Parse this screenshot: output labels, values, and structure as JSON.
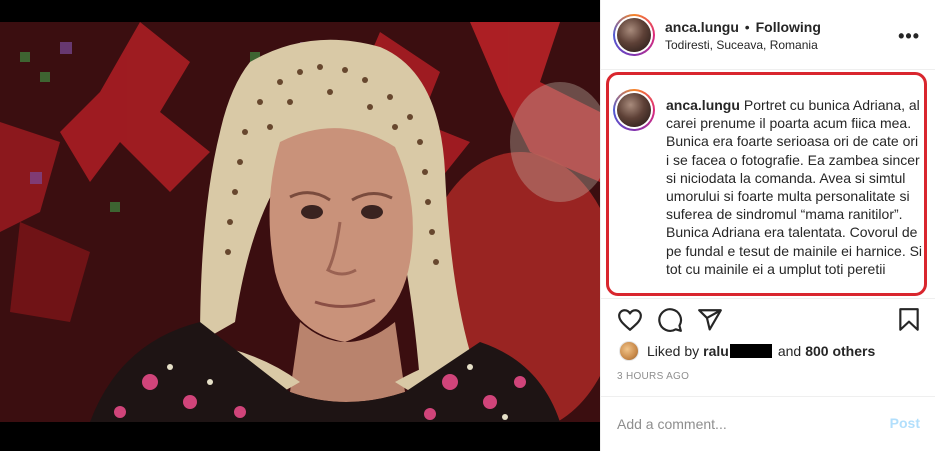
{
  "post": {
    "username": "anca.lungu",
    "separator": "•",
    "follow_status": "Following",
    "location": "Todiresti, Suceava, Romania",
    "more_label": "•••"
  },
  "caption": {
    "username": "anca.lungu",
    "text": "Portret cu bunica Adriana, al carei prenume il poarta acum fiica mea. Bunica era foarte serioasa ori de cate ori i se facea o fotografie. Ea zambea sincer si niciodata la comanda. Avea si simtul umorului si foarte multa personalitate si suferea de sindromul “mama ranitilor”. Bunica Adriana era talentata. Covorul de pe fundal e tesut de mainile ei harnice. Si tot cu mainile ei a umplut toti peretii"
  },
  "likes": {
    "prefix": "Liked by",
    "liker": "ralu",
    "and": "and",
    "others": "800 others"
  },
  "timestamp": "3 HOURS AGO",
  "comment": {
    "placeholder": "Add a comment...",
    "post_label": "Post"
  },
  "icons": {
    "like": "heart-icon",
    "comment": "comment-bubble-icon",
    "share": "paper-plane-icon",
    "save": "bookmark-icon",
    "more": "more-options-icon"
  },
  "colors": {
    "highlight_box": "#d9262e",
    "post_button": "#b2dffc",
    "text": "#262626",
    "muted": "#8e8e8e"
  }
}
